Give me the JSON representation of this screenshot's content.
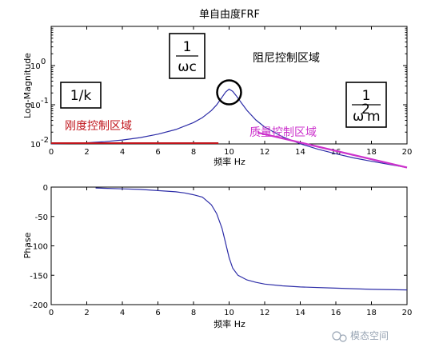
{
  "chart_data": [
    {
      "type": "line",
      "title": "单自由度FRF",
      "xlabel": "频率 Hz",
      "ylabel": "Log-Magnitude",
      "xlim": [
        0,
        20
      ],
      "y_scale": "log",
      "ylim": [
        0.001,
        10
      ],
      "xticks": [
        "0",
        "2",
        "4",
        "6",
        "8",
        "10",
        "12",
        "14",
        "16",
        "18",
        "20"
      ],
      "yticks": [
        {
          "base": "10",
          "exp": "0",
          "value": 1
        },
        {
          "base": "10",
          "exp": "-1",
          "value": 0.1
        },
        {
          "base": "10",
          "exp": "-2",
          "value": 0.01
        }
      ],
      "series": [
        {
          "x": [
            0,
            1,
            2,
            3,
            4,
            5,
            6,
            7,
            8,
            8.5,
            9,
            9.3,
            9.6,
            9.8,
            10,
            10.2,
            10.4,
            10.7,
            11,
            11.5,
            12,
            13,
            14,
            15,
            16,
            17,
            18,
            19,
            20
          ],
          "y": [
            0.0102,
            0.0103,
            0.0107,
            0.0114,
            0.0126,
            0.0145,
            0.0177,
            0.0233,
            0.035,
            0.047,
            0.071,
            0.099,
            0.155,
            0.21,
            0.25,
            0.22,
            0.17,
            0.11,
            0.072,
            0.041,
            0.027,
            0.0152,
            0.0101,
            0.0073,
            0.0056,
            0.0044,
            0.0036,
            0.003,
            0.0025
          ],
          "color": "#2e2ea8"
        }
      ],
      "annotations": {
        "stiffness": {
          "label": "刚度控制区域",
          "box": "1/k",
          "color": "#c0141b",
          "line": {
            "x": [
              0,
              9.4
            ],
            "y": 0.0105
          }
        },
        "damping": {
          "label": "阻尼控制区域",
          "box_num": "1",
          "box_den": "ωc",
          "color": "#000000",
          "circle": {
            "x": 10,
            "y": 0.25
          }
        },
        "mass": {
          "label": "质量控制区域",
          "box_num": "1",
          "box_den": "ω",
          "box_den_sup": "2",
          "box_den_tail": "m",
          "color": "#cc33cc",
          "line": {
            "x": [
              11.6,
              20
            ],
            "y": [
              0.0195,
              0.0025
            ]
          }
        }
      }
    },
    {
      "type": "line",
      "title": "",
      "xlabel": "频率 Hz",
      "ylabel": "Phase",
      "xlim": [
        0,
        20
      ],
      "ylim": [
        -200,
        0
      ],
      "xticks": [
        "0",
        "2",
        "4",
        "6",
        "8",
        "10",
        "12",
        "14",
        "16",
        "18",
        "20"
      ],
      "yticks": [
        "0",
        "-50",
        "-100",
        "-150",
        "-200"
      ],
      "series": [
        {
          "x": [
            2.5,
            3,
            4,
            5,
            6,
            7,
            7.5,
            8,
            8.5,
            9,
            9.3,
            9.6,
            9.8,
            10,
            10.2,
            10.5,
            11,
            11.5,
            12,
            13,
            14,
            16,
            18,
            20
          ],
          "y": [
            -1.5,
            -2,
            -3,
            -4,
            -6,
            -8,
            -10,
            -13,
            -17,
            -30,
            -45,
            -70,
            -95,
            -120,
            -138,
            -150,
            -158,
            -162,
            -165,
            -168,
            -170,
            -172,
            -174,
            -175
          ],
          "color": "#2e2ea8"
        }
      ]
    }
  ],
  "watermark": "模态空间"
}
